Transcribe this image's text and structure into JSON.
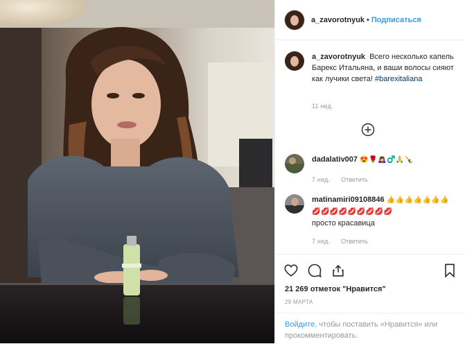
{
  "post": {
    "username": "a_zavorotnyuk",
    "separator": "•",
    "follow_label": "Подписаться"
  },
  "caption": {
    "username": "a_zavorotnyuk",
    "text": "Всего несколько капель Барекс Итальяна, и ваши волосы сияют как лучики света!",
    "hashtag": "#barexitaliana",
    "time": "11 нед."
  },
  "comments": [
    {
      "username": "dadalativ007",
      "text": "😍🌹🙇‍♀️♂️🙏🍾",
      "time": "7 нед.",
      "reply_label": "Ответить"
    },
    {
      "username": "matinamiri09108846",
      "text": "👍👍👍👍👍👍👍💋💋💋💋💋💋💋💋💋",
      "text2": "просто красавица",
      "time": "7 нед.",
      "reply_label": "Ответить"
    }
  ],
  "icons": {
    "load_more": "plus-circle-icon",
    "like": "heart-icon",
    "comment": "comment-icon",
    "share": "share-icon",
    "save": "bookmark-icon"
  },
  "likes": "21 269 отметок \"Нравится\"",
  "date": "29 марта",
  "login": {
    "link": "Войдите",
    "text": ", чтобы поставить «Нравится» или прокомментировать."
  },
  "colors": {
    "link_blue": "#3897f0",
    "hashtag": "#003569",
    "muted": "#999999",
    "border": "#efefef"
  }
}
